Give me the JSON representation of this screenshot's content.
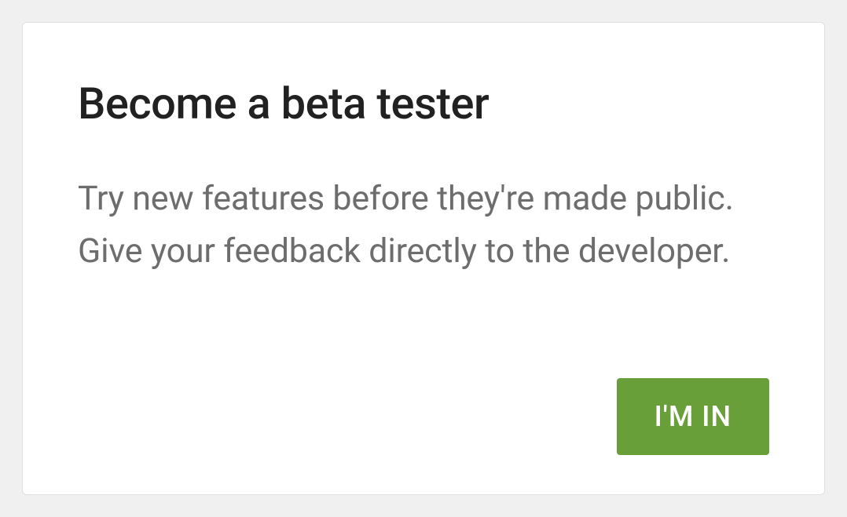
{
  "card": {
    "title": "Become a beta tester",
    "description": "Try new features before they're made public. Give your feedback directly to the developer.",
    "action_label": "I'M IN"
  }
}
